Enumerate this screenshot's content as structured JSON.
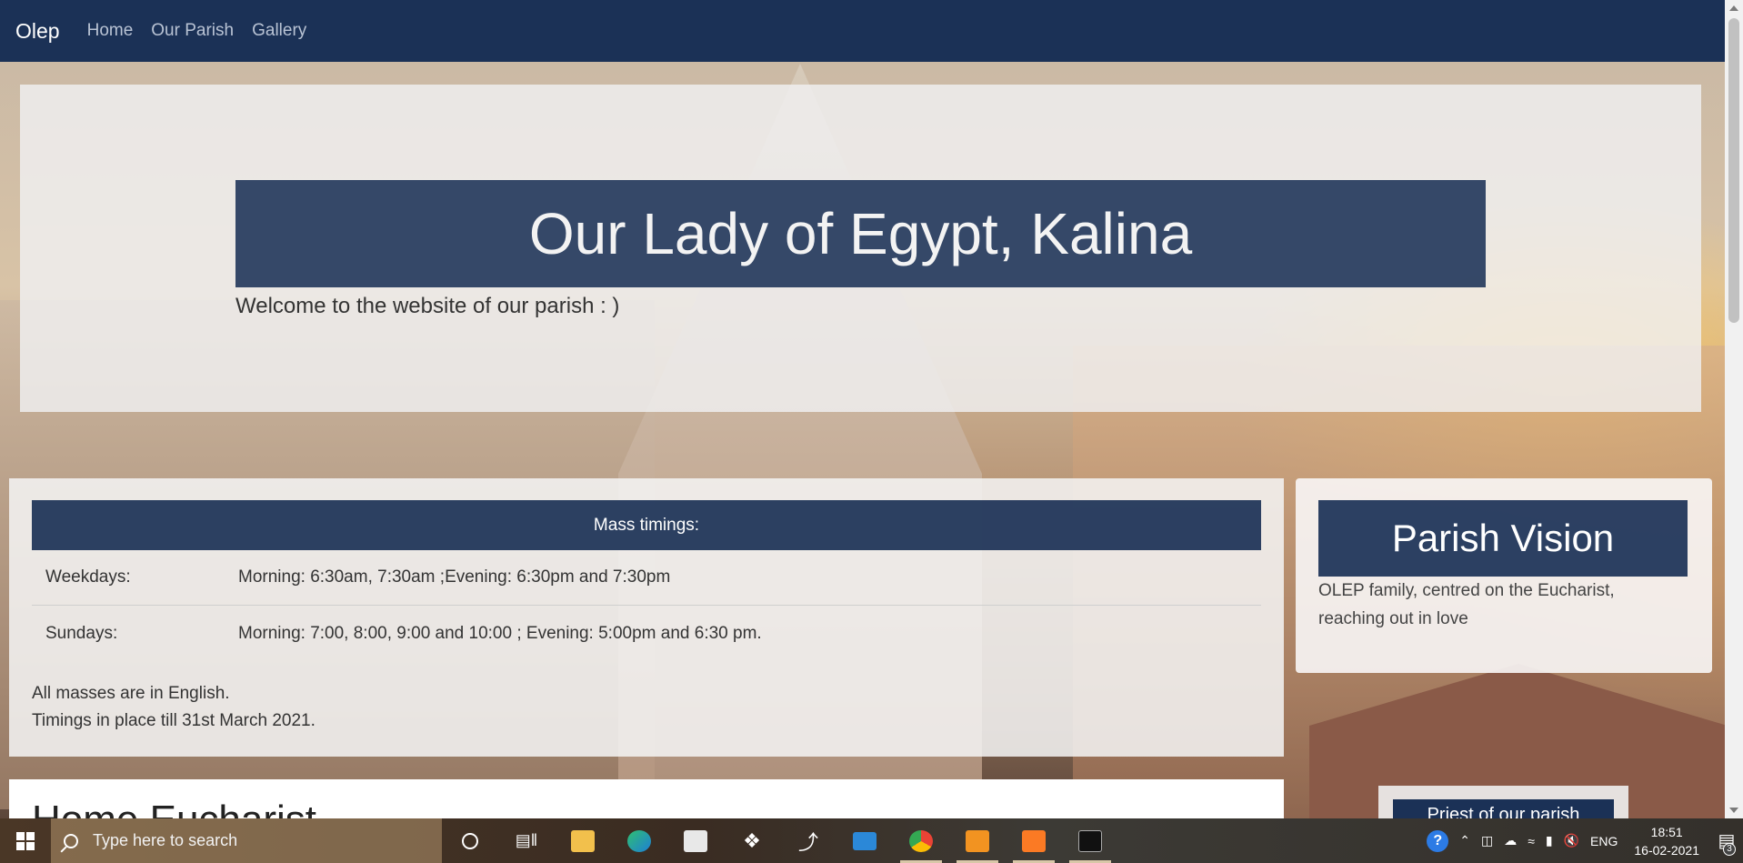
{
  "navbar": {
    "brand": "Olep",
    "links": [
      "Home",
      "Our Parish",
      "Gallery"
    ]
  },
  "jumbotron": {
    "title": "Our Lady of Egypt, Kalina",
    "welcome": "Welcome to the website of our parish : )"
  },
  "mass": {
    "header": "Mass timings:",
    "rows": [
      {
        "day": "Weekdays:",
        "times": "Morning: 6:30am, 7:30am ;Evening: 6:30pm and 7:30pm"
      },
      {
        "day": "Sundays:",
        "times": "Morning: 7:00, 8:00, 9:00 and 10:00 ; Evening: 5:00pm and 6:30 pm."
      }
    ],
    "notes": [
      "All masses are in English.",
      "Timings in place till 31st March 2021."
    ]
  },
  "vision": {
    "title": "Parish Vision",
    "text": "OLEP family, centred on the Eucharist, reaching out in love"
  },
  "lower": {
    "title": "Home Eucharist",
    "priest_button": "Priest of our parish"
  },
  "taskbar": {
    "search_placeholder": "Type here to search",
    "language": "ENG",
    "time": "18:51",
    "date": "16-02-2021",
    "notification_count": "3",
    "help_label": "?"
  },
  "colors": {
    "navy": "#1b3156",
    "nav_link": "#b9c3d4"
  }
}
